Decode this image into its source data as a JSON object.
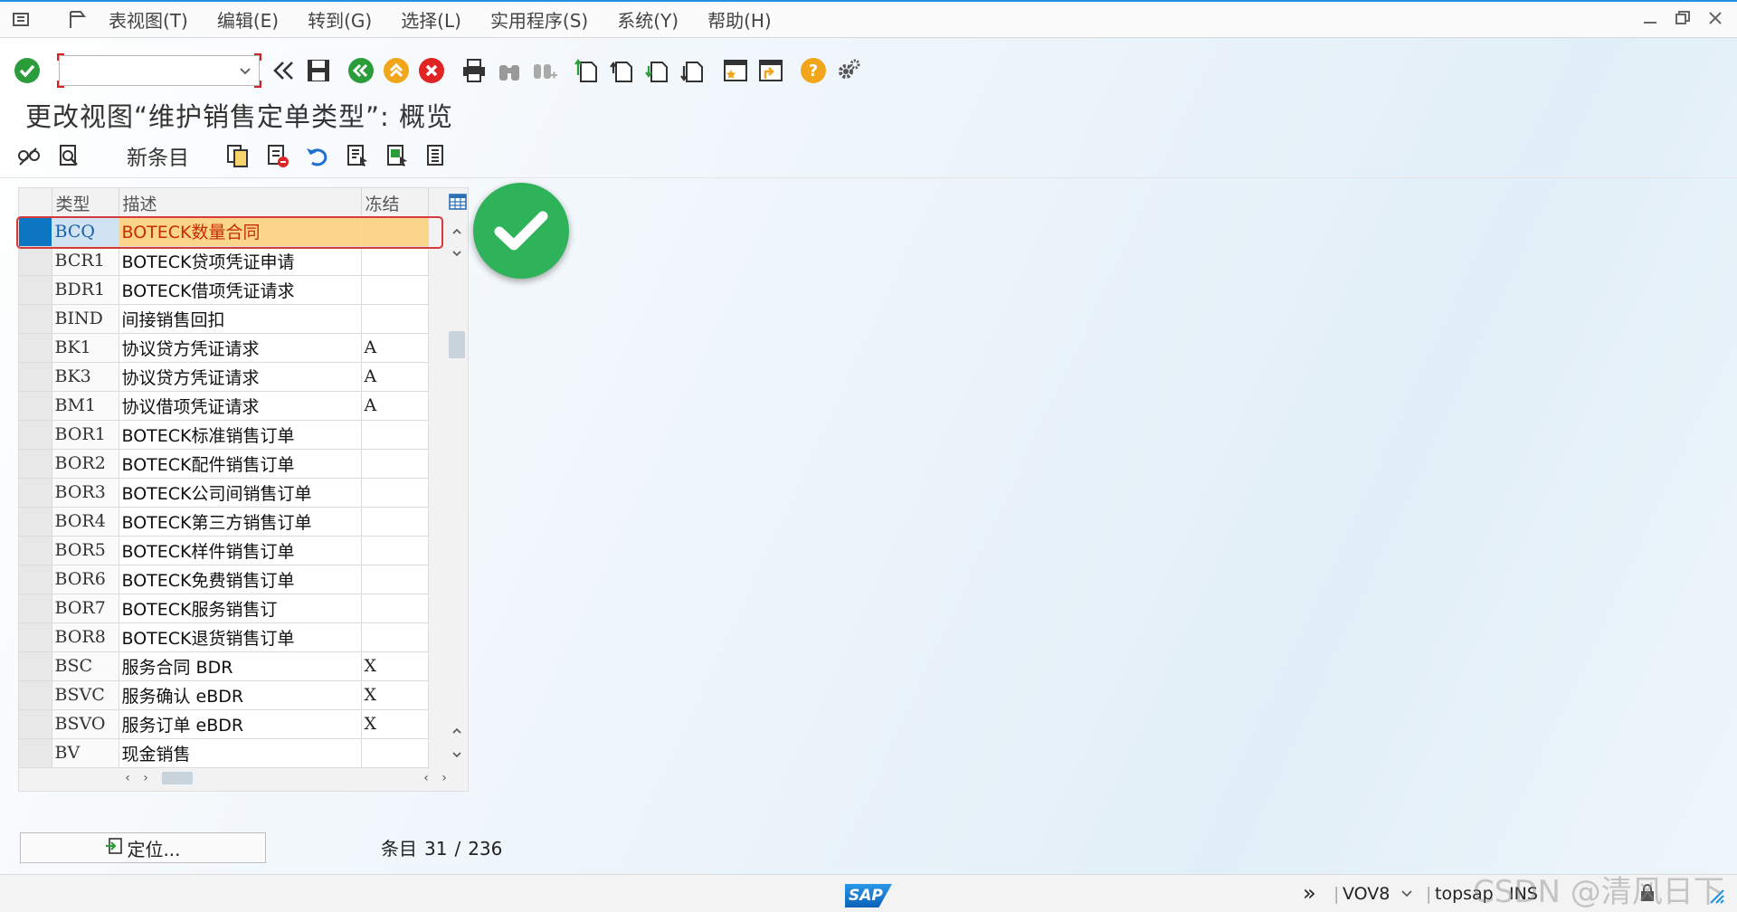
{
  "menu": {
    "items": [
      "表视图(T)",
      "编辑(E)",
      "转到(G)",
      "选择(L)",
      "实用程序(S)",
      "系统(Y)",
      "帮助(H)"
    ]
  },
  "toolbar": {
    "command_value": "",
    "icons": [
      "check-icon",
      "double-left-icon",
      "save-icon",
      "back-icon",
      "exit-icon",
      "cancel-icon",
      "print-icon",
      "find-icon",
      "find-next-icon",
      "first-page-icon",
      "prev-page-icon",
      "next-page-icon",
      "last-page-icon",
      "create-session-icon",
      "shortcut-icon",
      "help-icon",
      "settings-icon"
    ]
  },
  "title": "更改视图“维护销售定单类型”: 概览",
  "app_toolbar": {
    "new_entries_label": "新条目"
  },
  "table": {
    "headers": {
      "type": "类型",
      "description": "描述",
      "frozen": "冻结"
    },
    "rows": [
      {
        "type": "BCQ",
        "desc": "BOTECK数量合同",
        "frozen": "",
        "selected": true
      },
      {
        "type": "BCR1",
        "desc": "BOTECK贷项凭证申请",
        "frozen": ""
      },
      {
        "type": "BDR1",
        "desc": "BOTECK借项凭证请求",
        "frozen": ""
      },
      {
        "type": "BIND",
        "desc": "间接销售回扣",
        "frozen": ""
      },
      {
        "type": "BK1",
        "desc": "协议贷方凭证请求",
        "frozen": "A"
      },
      {
        "type": "BK3",
        "desc": "协议贷方凭证请求",
        "frozen": "A"
      },
      {
        "type": "BM1",
        "desc": "协议借项凭证请求",
        "frozen": "A"
      },
      {
        "type": "BOR1",
        "desc": "BOTECK标准销售订单",
        "frozen": ""
      },
      {
        "type": "BOR2",
        "desc": "BOTECK配件销售订单",
        "frozen": ""
      },
      {
        "type": "BOR3",
        "desc": "BOTECK公司间销售订单",
        "frozen": ""
      },
      {
        "type": "BOR4",
        "desc": "BOTECK第三方销售订单",
        "frozen": ""
      },
      {
        "type": "BOR5",
        "desc": "BOTECK样件销售订单",
        "frozen": ""
      },
      {
        "type": "BOR6",
        "desc": "BOTECK免费销售订单",
        "frozen": ""
      },
      {
        "type": "BOR7",
        "desc": "BOTECK服务销售订",
        "frozen": ""
      },
      {
        "type": "BOR8",
        "desc": "BOTECK退货销售订单",
        "frozen": ""
      },
      {
        "type": "BSC",
        "desc": "服务合同 BDR",
        "frozen": "X"
      },
      {
        "type": "BSVC",
        "desc": "服务确认 eBDR",
        "frozen": "X"
      },
      {
        "type": "BSVO",
        "desc": "服务订单 eBDR",
        "frozen": "X"
      },
      {
        "type": "BV",
        "desc": "现金销售",
        "frozen": ""
      }
    ]
  },
  "position_button": {
    "label": "定位..."
  },
  "entries": {
    "label": "条目",
    "current": "31",
    "separator": "/",
    "total": "236"
  },
  "status": {
    "sap_logo": "SAP",
    "transaction": "VOV8",
    "user": "topsap",
    "mode": "INS"
  },
  "watermark": "CSDN @清风日下",
  "colors": {
    "accent": "#1f8fe0",
    "selected_row_bg": "#fbd58a",
    "selected_row_text": "#c82d00",
    "ok_badge": "#2fb35a",
    "highlight_border": "#d83a3a"
  }
}
